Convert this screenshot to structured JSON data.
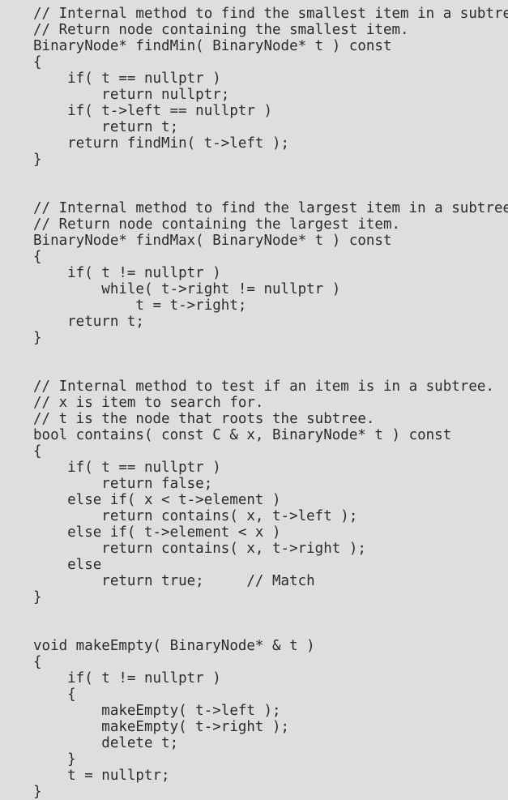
{
  "document": {
    "kind": "source-code-listing",
    "language": "C++",
    "background_color": "#dedede",
    "text_color": "#2b2b2b",
    "line_count": 44,
    "indent_spaces": 4
  },
  "code": {
    "lines": [
      "// Internal method to find the smallest item in a subtree t.",
      "// Return node containing the smallest item.",
      "BinaryNode* findMin( BinaryNode* t ) const",
      "{",
      "    if( t == nullptr )",
      "        return nullptr;",
      "    if( t->left == nullptr )",
      "        return t;",
      "    return findMin( t->left );",
      "}",
      "",
      "",
      "// Internal method to find the largest item in a subtree t.",
      "// Return node containing the largest item.",
      "BinaryNode* findMax( BinaryNode* t ) const",
      "{",
      "    if( t != nullptr )",
      "        while( t->right != nullptr )",
      "            t = t->right;",
      "    return t;",
      "}",
      "",
      "",
      "// Internal method to test if an item is in a subtree.",
      "// x is item to search for.",
      "// t is the node that roots the subtree.",
      "bool contains( const C & x, BinaryNode* t ) const",
      "{",
      "    if( t == nullptr )",
      "        return false;",
      "    else if( x < t->element )",
      "        return contains( x, t->left );",
      "    else if( t->element < x )",
      "        return contains( x, t->right );",
      "    else",
      "        return true;     // Match",
      "}",
      "",
      "",
      "void makeEmpty( BinaryNode* & t )",
      "{",
      "    if( t != nullptr )",
      "    {",
      "        makeEmpty( t->left );",
      "        makeEmpty( t->right );",
      "        delete t;",
      "    }",
      "    t = nullptr;",
      "}"
    ]
  }
}
